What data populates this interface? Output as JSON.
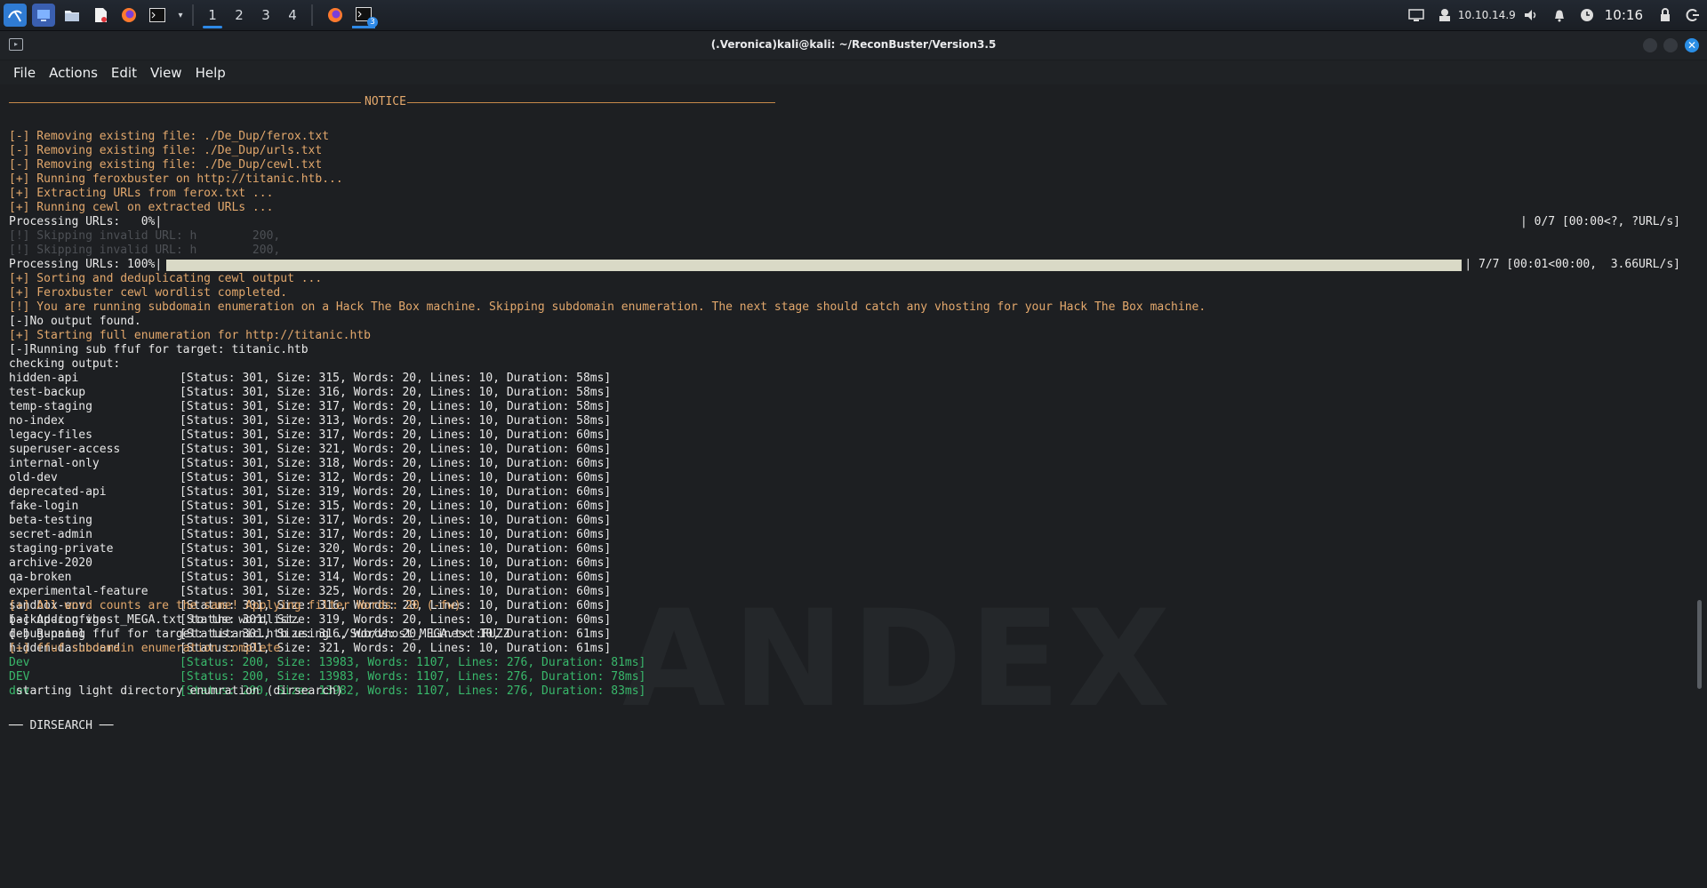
{
  "taskbar": {
    "workspaces": [
      "1",
      "2",
      "3",
      "4"
    ],
    "active_workspace": "1",
    "terminal_badge": "3",
    "ip": "10.10.14.9",
    "clock": "10:16"
  },
  "window": {
    "title": "(.Veronica)kali@kali: ~/ReconBuster/Version3.5"
  },
  "menu": [
    "File",
    "Actions",
    "Edit",
    "View",
    "Help"
  ],
  "terminal": {
    "notice_label": "NOTICE",
    "header_lines": [
      "[-] Removing existing file: ./De_Dup/ferox.txt",
      "[-] Removing existing file: ./De_Dup/urls.txt",
      "[-] Removing existing file: ./De_Dup/cewl.txt",
      "[+] Running feroxbuster on http://titanic.htb...",
      "[+] Extracting URLs from ferox.txt ...",
      "[+] Running cewl on extracted URLs ..."
    ],
    "progress0": {
      "label": "Processing URLs:   0%|",
      "right": "| 0/7 [00:00<?, ?URL/s]",
      "fraction": 0.0
    },
    "skip_lines": [
      "[!] Skipping invalid URL: h        200,",
      "[!] Skipping invalid URL: h        200,"
    ],
    "progress100": {
      "label": "Processing URLs: 100%|",
      "right": "| 7/7 [00:01<00:00,  3.66URL/s]",
      "fraction": 1.0
    },
    "middle_lines": [
      {
        "text": "[+] Sorting and deduplicating cewl output ...",
        "color": "orange"
      },
      {
        "text": "[+] Feroxbuster cewl wordlist completed.",
        "color": "orange"
      },
      {
        "text": "[!] You are running subdomain enumeration on a Hack The Box machine. Skipping subdomain enumeration. The next stage should catch any vhosting for your Hack The Box machine.",
        "color": "orange"
      },
      {
        "text": "[-]No output found.",
        "color": "white"
      },
      {
        "text": "[+] Starting full enumeration for http://titanic.htb",
        "color": "orange"
      },
      {
        "text": "[-]Running sub ffuf for target: titanic.htb",
        "color": "white"
      },
      {
        "text": "checking output:",
        "color": "white"
      }
    ],
    "subdomains": [
      {
        "name": "hidden-api",
        "result": "[Status: 301, Size: 315, Words: 20, Lines: 10, Duration: 58ms]"
      },
      {
        "name": "test-backup",
        "result": "[Status: 301, Size: 316, Words: 20, Lines: 10, Duration: 58ms]"
      },
      {
        "name": "temp-staging",
        "result": "[Status: 301, Size: 317, Words: 20, Lines: 10, Duration: 58ms]"
      },
      {
        "name": "no-index",
        "result": "[Status: 301, Size: 313, Words: 20, Lines: 10, Duration: 58ms]"
      },
      {
        "name": "legacy-files",
        "result": "[Status: 301, Size: 317, Words: 20, Lines: 10, Duration: 60ms]"
      },
      {
        "name": "superuser-access",
        "result": "[Status: 301, Size: 321, Words: 20, Lines: 10, Duration: 60ms]"
      },
      {
        "name": "internal-only",
        "result": "[Status: 301, Size: 318, Words: 20, Lines: 10, Duration: 60ms]"
      },
      {
        "name": "old-dev",
        "result": "[Status: 301, Size: 312, Words: 20, Lines: 10, Duration: 60ms]"
      },
      {
        "name": "deprecated-api",
        "result": "[Status: 301, Size: 319, Words: 20, Lines: 10, Duration: 60ms]"
      },
      {
        "name": "fake-login",
        "result": "[Status: 301, Size: 315, Words: 20, Lines: 10, Duration: 60ms]"
      },
      {
        "name": "beta-testing",
        "result": "[Status: 301, Size: 317, Words: 20, Lines: 10, Duration: 60ms]"
      },
      {
        "name": "secret-admin",
        "result": "[Status: 301, Size: 317, Words: 20, Lines: 10, Duration: 60ms]"
      },
      {
        "name": "staging-private",
        "result": "[Status: 301, Size: 320, Words: 20, Lines: 10, Duration: 60ms]"
      },
      {
        "name": "archive-2020",
        "result": "[Status: 301, Size: 317, Words: 20, Lines: 10, Duration: 60ms]"
      },
      {
        "name": "qa-broken",
        "result": "[Status: 301, Size: 314, Words: 20, Lines: 10, Duration: 60ms]"
      },
      {
        "name": "experimental-feature",
        "result": "[Status: 301, Size: 325, Words: 20, Lines: 10, Duration: 60ms]"
      },
      {
        "name": "sandbox-env",
        "result": "[Status: 301, Size: 316, Words: 20, Lines: 10, Duration: 60ms]"
      },
      {
        "name": "backup-configs",
        "result": "[Status: 301, Size: 319, Words: 20, Lines: 10, Duration: 60ms]"
      },
      {
        "name": "debug-panel",
        "result": "[Status: 301, Size: 316, Words: 20, Lines: 10, Duration: 61ms]"
      },
      {
        "name": "hidden-dashboard",
        "result": "[Status: 301, Size: 321, Words: 20, Lines: 10, Duration: 61ms]"
      }
    ],
    "filter_lines": [
      {
        "text": "[+] All word counts are the same! Applying filter Words: 20 (-fw)",
        "color": "orange"
      },
      {
        "text": "[-] Adding vhost_MEGA.txt to the wordlist.",
        "color": "white"
      },
      {
        "text": "[-] Running ffuf for target: titanic.htb using ./Sub/vhost_MEGA.txt:FUZZ",
        "color": "white"
      },
      {
        "text": "[+] ffuf subdomain enumeration complete",
        "color": "orange"
      }
    ],
    "vhosts": [
      {
        "name": "Dev",
        "result": "[Status: 200, Size: 13983, Words: 1107, Lines: 276, Duration: 81ms]"
      },
      {
        "name": "DEV",
        "result": "[Status: 200, Size: 13983, Words: 1107, Lines: 276, Duration: 78ms]"
      },
      {
        "name": "dev",
        "result": "[Status: 200, Size: 13982, Words: 1107, Lines: 276, Duration: 83ms]"
      }
    ],
    "dirsearch_start": " starting light directory enumration (dirsearch)",
    "dirsearch_label": "── DIRSEARCH ──"
  },
  "colors": {
    "orange": "#e3a86c",
    "white": "#e9e9e9",
    "green": "#39b86b",
    "accent": "#2e89e6"
  }
}
